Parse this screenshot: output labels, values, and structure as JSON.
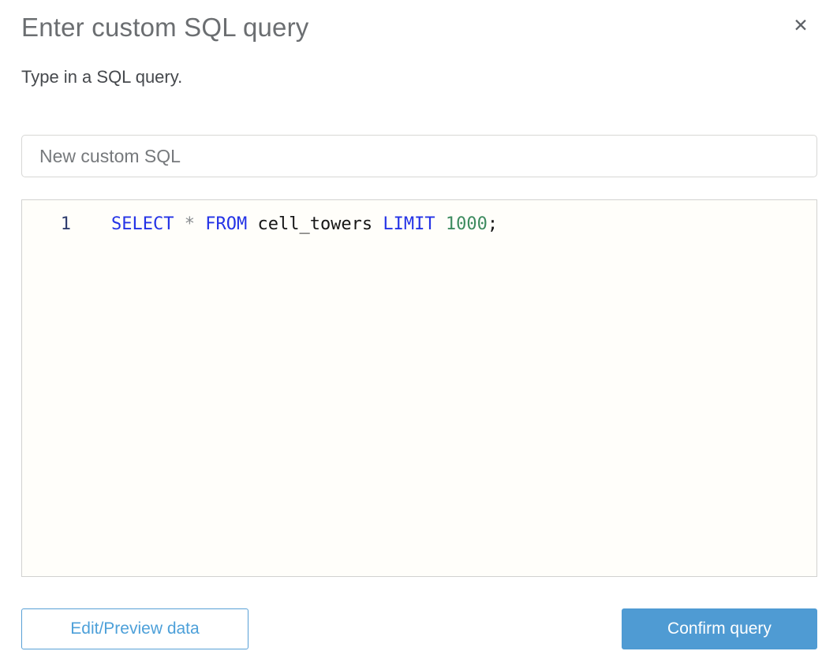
{
  "dialog": {
    "title": "Enter custom SQL query",
    "subtitle": "Type in a SQL query.",
    "close_icon_glyph": "✕"
  },
  "name_field": {
    "value": "New custom SQL"
  },
  "editor": {
    "line_number": "1",
    "query_full": "SELECT * FROM cell_towers LIMIT 1000;",
    "tokens": [
      {
        "text": "SELECT",
        "type": "keyword"
      },
      {
        "text": " ",
        "type": "plain"
      },
      {
        "text": "*",
        "type": "operator"
      },
      {
        "text": " ",
        "type": "plain"
      },
      {
        "text": "FROM",
        "type": "keyword"
      },
      {
        "text": " ",
        "type": "plain"
      },
      {
        "text": "cell_towers",
        "type": "identifier"
      },
      {
        "text": " ",
        "type": "plain"
      },
      {
        "text": "LIMIT",
        "type": "keyword"
      },
      {
        "text": " ",
        "type": "plain"
      },
      {
        "text": "1000",
        "type": "number"
      },
      {
        "text": ";",
        "type": "plain"
      }
    ]
  },
  "buttons": {
    "secondary_label": "Edit/Preview data",
    "primary_label": "Confirm query"
  },
  "colors": {
    "accent_blue": "#4f9bd3",
    "secondary_border_blue": "#58a0d6",
    "keyword_blue": "#2433e6",
    "number_green": "#3d8b5f",
    "operator_gray": "#8a8d90",
    "editor_background": "#fffefa",
    "title_gray": "#6b6e71"
  }
}
